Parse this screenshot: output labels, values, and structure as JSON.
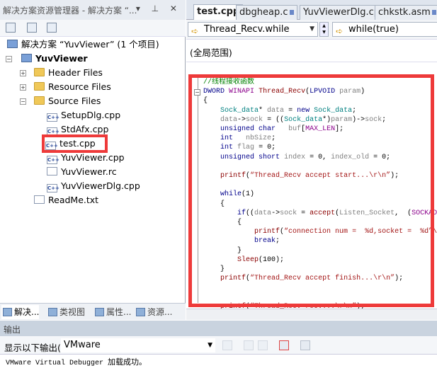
{
  "solution_explorer": {
    "title": "解决方案资源管理器 - 解决方案 “...",
    "title_buttons": "▾ ⊥ ✕",
    "tree": [
      {
        "label": "解决方案 “YuvViewer” (1 个项目)",
        "icon": "solution-icon",
        "level": 0
      },
      {
        "label": "YuvViewer",
        "icon": "project-icon",
        "level": 0,
        "bold": true,
        "expander": "−"
      },
      {
        "label": "Header Files",
        "icon": "folder-icon",
        "level": 1,
        "expander": "+"
      },
      {
        "label": "Resource Files",
        "icon": "folder-icon",
        "level": 1,
        "expander": "+"
      },
      {
        "label": "Source Files",
        "icon": "folder-open-icon",
        "level": 1,
        "expander": "−"
      },
      {
        "label": "SetupDlg.cpp",
        "icon": "cpp-file-icon",
        "level": 2
      },
      {
        "label": "StdAfx.cpp",
        "icon": "cpp-file-icon",
        "level": 2
      },
      {
        "label": "test.cpp",
        "icon": "cpp-file-icon",
        "level": 2,
        "highlighted": true
      },
      {
        "label": "YuvViewer.cpp",
        "icon": "cpp-file-icon",
        "level": 2
      },
      {
        "label": "YuvViewer.rc",
        "icon": "resource-file-icon",
        "level": 2
      },
      {
        "label": "YuvViewerDlg.cpp",
        "icon": "cpp-file-icon",
        "level": 2
      },
      {
        "label": "ReadMe.txt",
        "icon": "text-file-icon",
        "level": 1
      }
    ],
    "bottom_tabs": [
      "解决...",
      "类视图",
      "属性...",
      "资源..."
    ]
  },
  "editor": {
    "tabs": [
      {
        "label": "test.cpp",
        "active": true
      },
      {
        "label": "dbgheap.c",
        "locked": true
      },
      {
        "label": "YuvViewerDlg.cpp"
      },
      {
        "label": "chkstk.asm",
        "locked": true
      }
    ],
    "nav_left": "Thread_Recv.while",
    "nav_right": "while(true)",
    "scope": "(全局范围)",
    "highlight_color": "#ee3a3a",
    "code": [
      [
        [
          "//线程接收函数",
          "cm"
        ]
      ],
      [
        [
          "DWORD",
          "kw"
        ],
        [
          " "
        ],
        [
          "WINAPI",
          "mac"
        ],
        [
          " "
        ],
        [
          "Thread_Recv",
          "fn"
        ],
        [
          "("
        ],
        [
          "LPVOID",
          "kw"
        ],
        [
          " "
        ],
        [
          "param",
          "va"
        ],
        [
          ")"
        ]
      ],
      [
        [
          "{"
        ]
      ],
      [
        [
          "    "
        ],
        [
          "Sock_data",
          "ty"
        ],
        [
          "* "
        ],
        [
          "data",
          "va"
        ],
        [
          " = "
        ],
        [
          "new",
          "kw"
        ],
        [
          " "
        ],
        [
          "Sock_data",
          "ty"
        ],
        [
          ";"
        ]
      ],
      [
        [
          "    "
        ],
        [
          "data",
          "va"
        ],
        [
          "->"
        ],
        [
          "sock",
          "va"
        ],
        [
          " = (("
        ],
        [
          "Sock_data",
          "ty"
        ],
        [
          "*)"
        ],
        [
          "param",
          "va"
        ],
        [
          ")->"
        ],
        [
          "sock",
          "va"
        ],
        [
          ";"
        ]
      ],
      [
        [
          "    "
        ],
        [
          "unsigned",
          "kw"
        ],
        [
          " "
        ],
        [
          "char",
          "kw"
        ],
        [
          "   "
        ],
        [
          "buf",
          "va"
        ],
        [
          "["
        ],
        [
          "MAX_LEN",
          "mac"
        ],
        [
          "];"
        ]
      ],
      [
        [
          "    "
        ],
        [
          "int",
          "kw"
        ],
        [
          "   "
        ],
        [
          "nbSize",
          "va"
        ],
        [
          ";"
        ]
      ],
      [
        [
          "    "
        ],
        [
          "int",
          "kw"
        ],
        [
          " "
        ],
        [
          "flag",
          "va"
        ],
        [
          " = 0;"
        ]
      ],
      [
        [
          "    "
        ],
        [
          "unsigned",
          "kw"
        ],
        [
          " "
        ],
        [
          "short",
          "kw"
        ],
        [
          " "
        ],
        [
          "index",
          "va"
        ],
        [
          " = 0, "
        ],
        [
          "index_old",
          "va"
        ],
        [
          " = 0;"
        ]
      ],
      [
        [
          ""
        ]
      ],
      [
        [
          "    "
        ],
        [
          "printf",
          "fn"
        ],
        [
          "("
        ],
        [
          "“Thread_Recv accept start...\\r\\n”",
          "str"
        ],
        [
          ");"
        ]
      ],
      [
        [
          ""
        ]
      ],
      [
        [
          "    "
        ],
        [
          "while",
          "kw"
        ],
        [
          "(1)"
        ]
      ],
      [
        [
          "    {"
        ]
      ],
      [
        [
          "        "
        ],
        [
          "if",
          "kw"
        ],
        [
          "(("
        ],
        [
          "data",
          "va"
        ],
        [
          "->"
        ],
        [
          "sock",
          "va"
        ],
        [
          " = "
        ],
        [
          "accept",
          "fn"
        ],
        [
          "("
        ],
        [
          "Listen_Socket",
          "va"
        ],
        [
          ",  ("
        ],
        [
          "SOCKADDR",
          "mac"
        ]
      ],
      [
        [
          "        {"
        ]
      ],
      [
        [
          "            "
        ],
        [
          "printf",
          "fn"
        ],
        [
          "("
        ],
        [
          "“connection num =  %d,socket =  %d”\\r",
          "str"
        ]
      ],
      [
        [
          "            "
        ],
        [
          "break",
          "kw"
        ],
        [
          ";"
        ]
      ],
      [
        [
          "        }"
        ]
      ],
      [
        [
          "        "
        ],
        [
          "Sleep",
          "fn"
        ],
        [
          "(100);"
        ]
      ],
      [
        [
          "    }"
        ]
      ],
      [
        [
          "    "
        ],
        [
          "printf",
          "fn"
        ],
        [
          "("
        ],
        [
          "“Thread_Recv accept finish...\\r\\n”",
          "str"
        ],
        [
          ");"
        ]
      ],
      [
        [
          ""
        ]
      ],
      [
        [
          ""
        ]
      ],
      [
        [
          "    "
        ],
        [
          "printf",
          "fn"
        ],
        [
          "("
        ],
        [
          "“Thread_Recv recv...\\r\\n”",
          "str"
        ],
        [
          ");"
        ]
      ]
    ]
  },
  "output": {
    "title": "输出",
    "show_label": "显示以下输出(S):",
    "source": "VMware",
    "text_latin": "VMware Virtual Debugger ",
    "text_cn": "加载成功。"
  }
}
